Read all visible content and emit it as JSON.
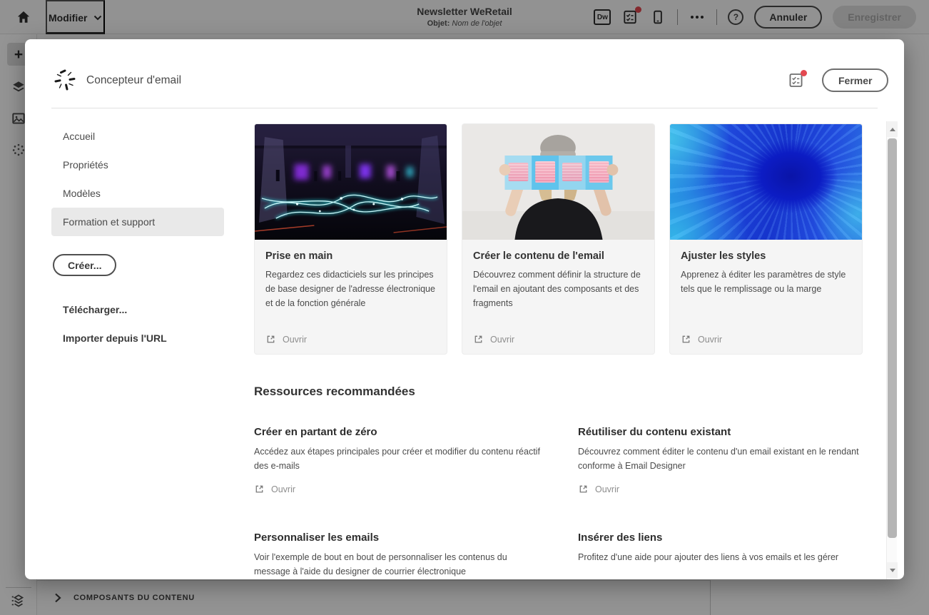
{
  "topbar": {
    "tab": "Modifier",
    "title": "Newsletter WeRetail",
    "subject_label": "Objet:",
    "subject_value": "Nom de l'objet",
    "dw_badge": "Dw",
    "help_glyph": "?",
    "cancel": "Annuler",
    "save": "Enregistrer"
  },
  "rail": {
    "plus_glyph": "+"
  },
  "bottom_panel": {
    "header": "COMPOSANTS DU CONTENU"
  },
  "modal": {
    "title": "Concepteur d'email",
    "close": "Fermer",
    "nav": [
      {
        "label": "Accueil"
      },
      {
        "label": "Propriétés"
      },
      {
        "label": "Modèles"
      },
      {
        "label": "Formation et support"
      }
    ],
    "create": "Créer...",
    "download": "Télécharger...",
    "import_url": "Importer depuis l'URL",
    "cards": [
      {
        "title": "Prise en main",
        "description": "Regardez ces didacticiels sur les principes de base designer de l'adresse électronique et de la fonction générale",
        "action": "Ouvrir",
        "image": "light-trails-dark-garage"
      },
      {
        "title": "Créer le contenu de l'email",
        "description": "Découvrez comment définir la structure de l'email en ajoutant des composants et des fragments",
        "action": "Ouvrir",
        "image": "person-holding-gradient-panels"
      },
      {
        "title": "Ajuster les styles",
        "description": "Apprenez à éditer les paramètres de style tels que le remplissage ou la marge",
        "action": "Ouvrir",
        "image": "blue-ink-swirl"
      }
    ],
    "resources_title": "Ressources recommandées",
    "resources": [
      {
        "title": "Créer en partant de zéro",
        "description": "Accédez aux étapes principales pour créer et modifier du contenu réactif des e-mails",
        "action": "Ouvrir"
      },
      {
        "title": "Réutiliser du contenu existant",
        "description": "Découvrez comment éditer le contenu d'un email existant en le rendant conforme à Email Designer",
        "action": "Ouvrir"
      },
      {
        "title": "Personnaliser les emails",
        "description": "Voir l'exemple de bout en bout de personnaliser les contenus du message à l'aide du designer de courrier électronique"
      },
      {
        "title": "Insérer des liens",
        "description": "Profitez d'une aide pour ajouter des liens à vos emails et les gérer"
      }
    ]
  },
  "colors": {
    "notification_red": "#e34850",
    "nav_selected_bg": "#e9e9e9",
    "card_body_bg": "#f5f5f5",
    "text_dark": "#323232",
    "text_muted": "#8d8d8d"
  }
}
